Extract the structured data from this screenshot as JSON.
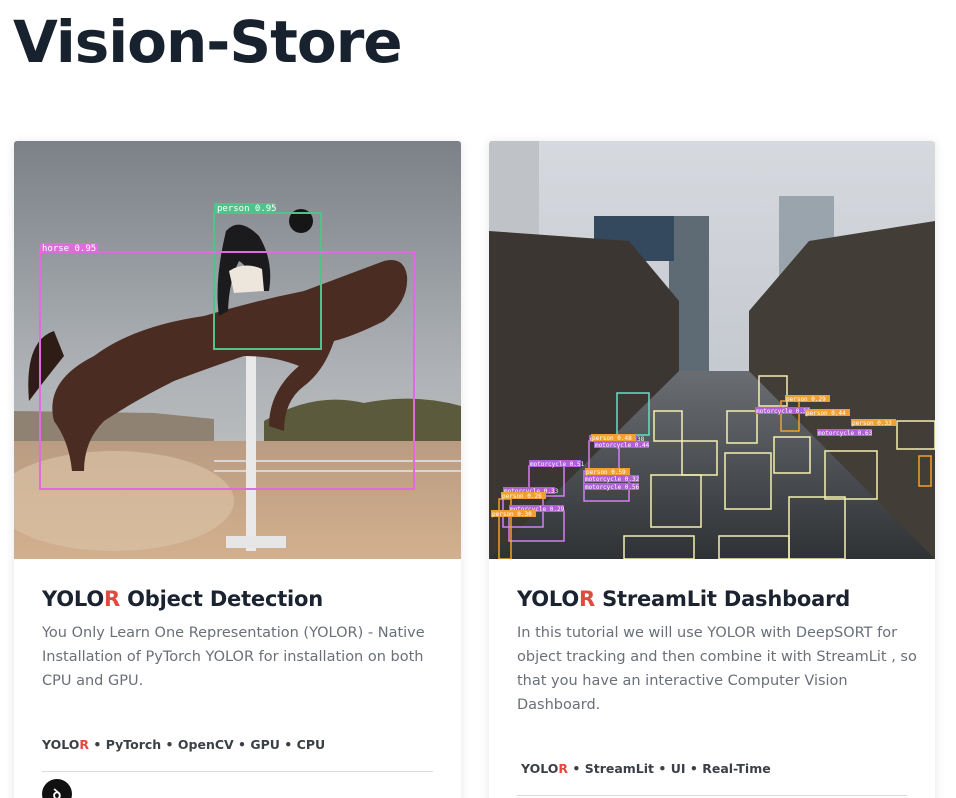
{
  "site": {
    "title": "Vision-Store"
  },
  "cards": [
    {
      "title_main": "YOLO",
      "title_accent": "R",
      "title_rest": " Object Detection",
      "description": "You Only Learn One Representation (YOLOR) - Native Installation of PyTorch YOLOR for installation on both CPU and GPU.",
      "tags_main": "YOLO",
      "tags_accent": "R",
      "tags_rest": " • PyTorch • OpenCV • GPU • CPU",
      "image_labels": {
        "person": "person 0.95",
        "horse": "horse 0.95"
      }
    },
    {
      "title_main": "YOLO",
      "title_accent": "R",
      "title_rest": " StreamLit Dashboard",
      "description": "In this tutorial we will use YOLOR with DeepSORT for object tracking and then combine it with StreamLit , so that you have an interactive Computer Vision Dashboard.",
      "tags_main": "YOLO",
      "tags_accent": "R",
      "tags_rest": " • StreamLit • UI • Real-Time",
      "image_labels": [
        "motorcycle 0.38",
        "motorcycle 0.51",
        "motorcycle 0.33",
        "motorcycle 0.32",
        "motorcycle 0.56",
        "motorcycle 0.29",
        "motorcycle 0.44",
        "motorcycle 0.30",
        "motorcycle 0.63",
        "person 0.48",
        "person 0.59",
        "person 0.26",
        "person 0.30",
        "person 0.29",
        "person 0.33",
        "person 0.44"
      ]
    }
  ],
  "colors": {
    "accent": "#e14a3f",
    "title": "#18222e",
    "text": "#6a6f78"
  },
  "icons": {
    "author": "user-avatar-icon"
  }
}
